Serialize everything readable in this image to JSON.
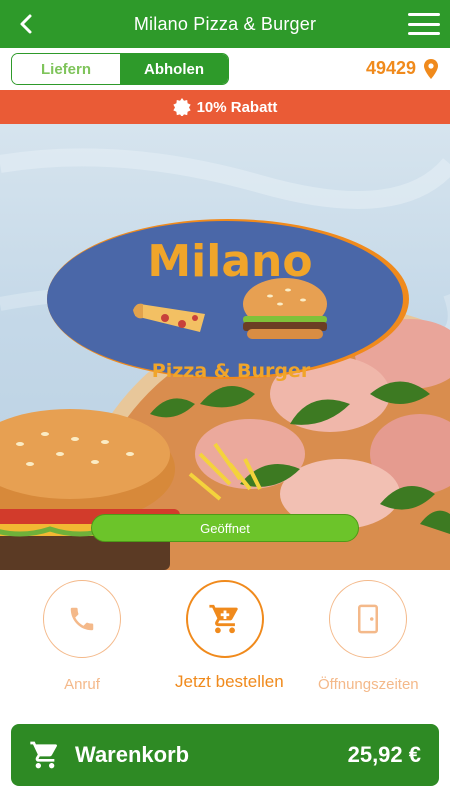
{
  "header": {
    "title": "Milano Pizza & Burger"
  },
  "mode": {
    "options": [
      "Liefern",
      "Abholen"
    ],
    "selected": "Abholen"
  },
  "location": {
    "postcode": "49429"
  },
  "discount": {
    "text": "10% Rabatt"
  },
  "hero": {
    "logo_title": "Milano",
    "logo_subtitle": "Pizza & Burger",
    "status": "Geöffnet"
  },
  "actions": [
    {
      "label": "Anruf",
      "icon": "phone-icon"
    },
    {
      "label": "Jetzt bestellen",
      "icon": "cart-icon"
    },
    {
      "label": "Öffnungszeiten",
      "icon": "door-icon"
    }
  ],
  "cart": {
    "label": "Warenkorb",
    "total": "25,92 €"
  },
  "colors": {
    "green": "#2e9a2a",
    "orange": "#f08a1c",
    "banner": "#ea5b36",
    "open": "#6cc42a"
  }
}
